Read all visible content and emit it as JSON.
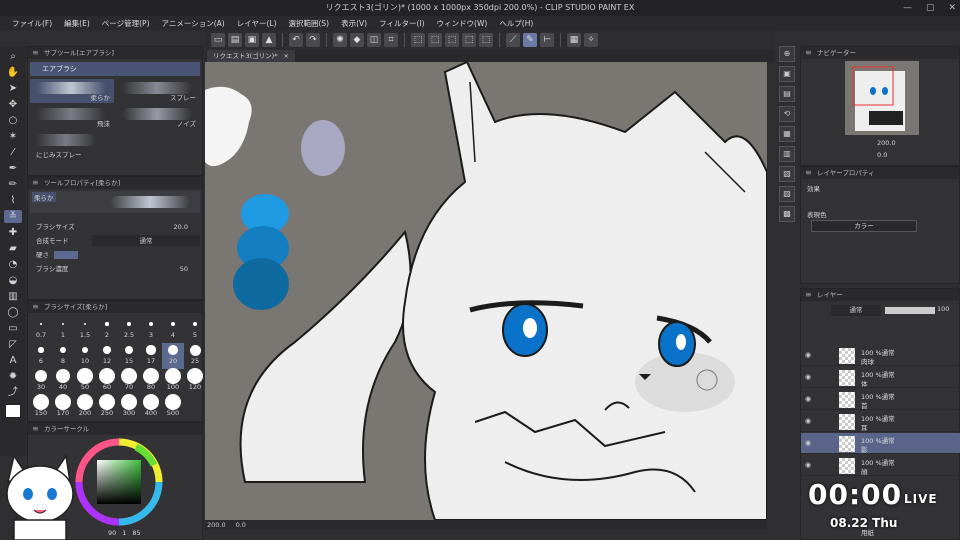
{
  "window": {
    "title": "リクエスト3(ゴリン)* (1000 x 1000px 350dpi 200.0%) - CLIP STUDIO PAINT EX",
    "controls": [
      "—",
      "▢",
      "✕"
    ]
  },
  "menu": [
    "ファイル(F)",
    "編集(E)",
    "ページ管理(P)",
    "アニメーション(A)",
    "レイヤー(L)",
    "選択範囲(S)",
    "表示(V)",
    "フィルター(I)",
    "ウィンドウ(W)",
    "ヘルプ(H)"
  ],
  "subtool": {
    "header": "サブツール[エアブラシ]",
    "category": "エアブラシ",
    "brushes": [
      "柔らか",
      "スプレー",
      "飛沫",
      "ノイズ",
      "にじみスプレー"
    ]
  },
  "toolprop": {
    "header": "ツールプロパティ[柔らか]",
    "current": "柔らか",
    "brush_size_label": "ブラシサイズ",
    "brush_size_value": "20.0",
    "blend_label": "合成モード",
    "blend_value": "通常",
    "hardness_label": "硬さ",
    "density_label": "ブラシ濃度",
    "density_value": "50"
  },
  "brushsize": {
    "header": "ブラシサイズ[柔らか]",
    "sizes": [
      "0.7",
      "1",
      "1.5",
      "2",
      "2.5",
      "3",
      "4",
      "5",
      "6",
      "8",
      "10",
      "12",
      "15",
      "17",
      "20",
      "25",
      "30",
      "40",
      "50",
      "60",
      "70",
      "80",
      "100",
      "120",
      "150",
      "170",
      "200",
      "250",
      "300",
      "400",
      "500"
    ],
    "selected": "20"
  },
  "colorcircle": {
    "header": "カラーサークル",
    "readout_left": "90",
    "readout_mid": "1",
    "readout_right": "85"
  },
  "canvas": {
    "tab_label": "リクエスト3(ゴリン)*",
    "zoom": "200.0",
    "rotation": "0.0"
  },
  "navigator": {
    "header": "ナビゲーター",
    "zoom_value": "200.0",
    "rotation_value": "0.0"
  },
  "layerprop": {
    "header": "レイヤープロパティ",
    "effect_label": "効果",
    "expression_label": "表現色",
    "expression_value": "カラー"
  },
  "layers": {
    "header": "レイヤー",
    "blend_mode": "通常",
    "opacity": "100",
    "items": [
      {
        "mode": "100 %通常",
        "name": "肉球",
        "selected": false
      },
      {
        "mode": "100 %通常",
        "name": "体",
        "selected": false
      },
      {
        "mode": "100 %通常",
        "name": "首",
        "selected": false
      },
      {
        "mode": "100 %通常",
        "name": "耳",
        "selected": false
      },
      {
        "mode": "100 %通常",
        "name": "影",
        "selected": true
      },
      {
        "mode": "100 %通常",
        "name": "顔",
        "selected": false
      }
    ],
    "footer_layer": "用紙"
  },
  "overlay": {
    "clock": "00:00",
    "live": "LIVE",
    "date": "08.22 Thu"
  },
  "colors": {
    "canvas_bg": "#7a7672",
    "fur": "#eeeeee",
    "eyes": "#0a72c8",
    "selected_layer": "#5a6488",
    "accent": "#5c6a90"
  }
}
